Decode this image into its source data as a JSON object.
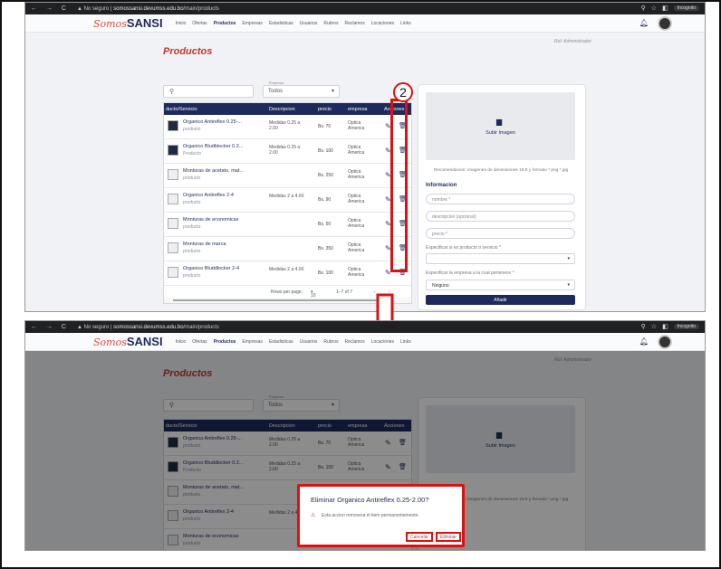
{
  "browser": {
    "not_secure": "No seguro",
    "url_host": "somossansi.devumss.edu.bo",
    "url_path": "/main/products",
    "profile": "Incognito"
  },
  "app": {
    "logo_script": "Somos",
    "logo_bold": "SANSI",
    "menu": [
      "Inicio",
      "Ofertas",
      "Productos",
      "Empresas",
      "Estadisticas",
      "Usuarios",
      "Rubros",
      "Reclamos",
      "Locaciones",
      "Links"
    ],
    "active_menu": "Productos",
    "role": "Rol: Administrador"
  },
  "page": {
    "title": "Productos",
    "search_icon": "search-icon",
    "company_filter_label": "Empresa",
    "company_filter_value": "Todos"
  },
  "table": {
    "headers": [
      "ducto/Servicio",
      "Descripcion",
      "precio",
      "empresa",
      "Acciones"
    ],
    "rows": [
      {
        "name": "Organico Antireflex 0.25-...",
        "type": "producto",
        "desc": "Medidas 0.25 a 2.00",
        "price": "Bs. 70",
        "company": "Optica America",
        "thumb": "dark"
      },
      {
        "name": "Organico Bludblocker 0.2...",
        "type": "Producto",
        "desc": "Medidas 0.25 a 2.00",
        "price": "Bs. 100",
        "company": "Optica America",
        "thumb": "dark"
      },
      {
        "name": "Monturas de acetato, mat...",
        "type": "producto",
        "desc": "",
        "price": "Bs. 250",
        "company": "Optica America",
        "thumb": "ph"
      },
      {
        "name": "Organico Antireflex 2-4",
        "type": "producto",
        "desc": "Medidas 2 a 4.00",
        "price": "Bs. 90",
        "company": "Optica America",
        "thumb": "ph"
      },
      {
        "name": "Monturas de economicas",
        "type": "producto",
        "desc": "",
        "price": "Bs. 50",
        "company": "Optica America",
        "thumb": "ph"
      },
      {
        "name": "Monturas de marca",
        "type": "producto",
        "desc": "",
        "price": "Bs. 350",
        "company": "Optica America",
        "thumb": "ph"
      },
      {
        "name": "Organico Bluddlocker 2-4",
        "type": "producto",
        "desc": "Medidas 2 a 4.00",
        "price": "Bs. 100",
        "company": "Optica America",
        "thumb": "ph"
      }
    ],
    "rows_per_page_label": "Rows per page:",
    "rows_per_page": "10",
    "range": "1–7 of 7"
  },
  "form": {
    "upload_label": "Subir Imagen",
    "recommendation": "Recomendacion: imagenes de dimensiones 16:9 y formato *.png *.jpg",
    "info_title": "Informacion",
    "name_placeholder": "nombre *",
    "desc_placeholder": "descripcion (opcional)",
    "price_placeholder": "precio *",
    "type_label": "Especificar si es producto o servicio *",
    "company_label": "Especificar la empresa a la cual pertenece *",
    "company_value": "Ninguno",
    "submit": "Añadir"
  },
  "annotation": {
    "step_number": "2"
  },
  "second_screen": {
    "url_path": "/main/products",
    "company_filter_value": "Todos",
    "rows": [
      {
        "name": "Organico Antireflex 0.25-...",
        "type": "producto",
        "desc": "Medidas 0.25 a 2.00",
        "price": "Bs. 70",
        "company": "Optica America",
        "thumb": "dark"
      },
      {
        "name": "Organico Bluddlocker 0.2...",
        "type": "Producto",
        "desc": "Medidas 0.25 a 2.00",
        "price": "Bs. 100",
        "company": "Optica America",
        "thumb": "dark"
      },
      {
        "name": "Monturas de acetato, mat...",
        "type": "producto",
        "desc": "",
        "price": "Bs. 250",
        "company": "Optica America",
        "thumb": "ph"
      },
      {
        "name": "Organico Antireflex 2-4",
        "type": "producto",
        "desc": "Medidas 2 a 4.00",
        "price": "Bs. 90",
        "company": "Optica America",
        "thumb": "ph"
      },
      {
        "name": "Monturas de economicas",
        "type": "producto",
        "desc": "",
        "price": "Bs. 50",
        "company": "Optica America",
        "thumb": "ph"
      }
    ],
    "upload_label": "Subir Imagen",
    "recommendation": "Recomendacion: imagenes de dimensiones 16:9 y formato *.png *.jpg",
    "dialog": {
      "title": "Eliminar Organico Antireflex 0.25-2.00?",
      "message": "Esta accion removera el item permanentemente.",
      "cancel": "Cancelar",
      "confirm": "Eliminar"
    }
  },
  "colors": {
    "navy": "#1d2a5c",
    "title_red": "#c0392b",
    "highlight_red": "#e10f0f"
  }
}
